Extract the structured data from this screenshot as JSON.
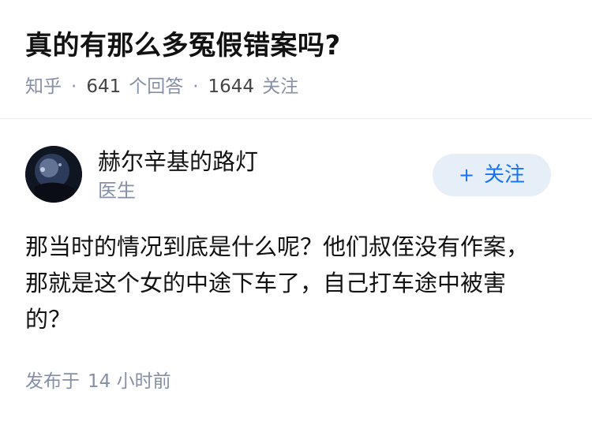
{
  "question": {
    "title": "真的有那么多冤假错案吗?",
    "source": "知乎",
    "answer_count": "641",
    "answer_label": "个回答",
    "follower_count": "1644",
    "follower_label": "关注",
    "separator": "·"
  },
  "author": {
    "name": "赫尔辛基的路灯",
    "bio": "医生",
    "follow_icon": "plus-icon",
    "follow_plus": "+",
    "follow_label": "关注"
  },
  "answer": {
    "lines": [
      "那当时的情况到底是什么呢？他们叔侄没有作案，",
      "那就是这个女的中途下车了，自己打车途中被害",
      "的？"
    ],
    "time_label": "发布于",
    "time_value": "14 小时前"
  },
  "colors": {
    "meta_gray": "#8590a6",
    "accent_blue": "#1772f6",
    "button_bg": "#e6eef8"
  }
}
